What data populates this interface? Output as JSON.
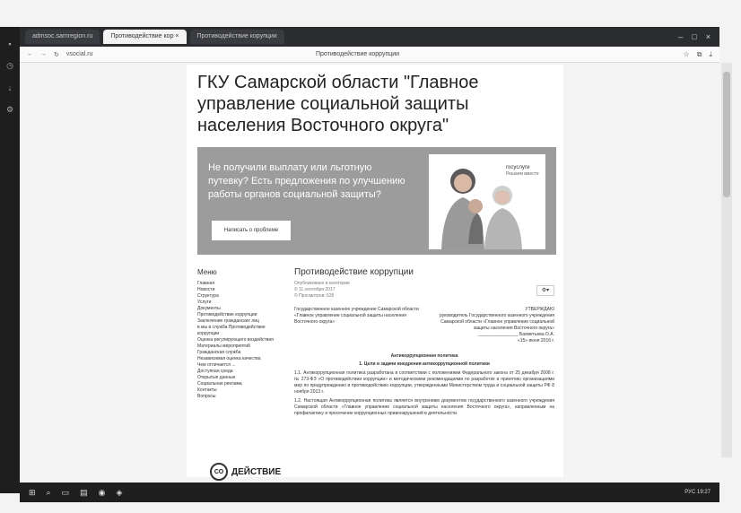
{
  "browser": {
    "tabs": [
      "admsoc.samregion.ru",
      "Противодействие кор ×",
      "Противодействие корупции"
    ],
    "page_title": "Противодействие коррупции",
    "url": "vsocial.ru"
  },
  "site": {
    "title": "ГКУ Самарской области \"Главное управление социальной защиты населения Восточного округа\""
  },
  "banner": {
    "text": "Не получили выплату или льготную путевку? Есть предложения по улучшению работы органов социальной защиты?",
    "button": "Написать о проблеме",
    "gos_label": "госуслуги",
    "gos_sub": "Решаем вместе"
  },
  "sidebar": {
    "title": "Меню",
    "items": [
      "Главная",
      "Новости",
      "Структура",
      "Услуги",
      "Документы",
      "Противодействие коррупции",
      "Заключение гражданских лиц",
      "в мы в служба Противодействие коррупции",
      "Оценка регулирующего воздействия",
      "Материалы мероприятий",
      "Гражданская служба",
      "Независимая оценка качества",
      "Чем отличается ...",
      "Доступная среда",
      "Открытые данные",
      "Социальная реклама",
      "Контакты",
      "Вопросы"
    ],
    "logo_text": "ДЕЙСТВИЕ",
    "logo_mark": "СО"
  },
  "content": {
    "heading": "Противодействие коррупции",
    "meta": "Опубликовано в категории\n© 11 сентября 2017\n© Просмотров: 635",
    "org_left": "Государственное казенное учреждение Самарской области «Главное управление социальной защиты населения Восточного округа»",
    "approved": "УТВЕРЖДАЮ\nруководитель Государственного казенного учреждения Самарской области «Главное управление социальной защиты населения Восточного округа»\n________________ Бахметьева О.А.\n«15» июня 2016 г.",
    "doc_title": "Антикоррупционная политика",
    "section1": "1. Цели и задачи внедрения антикоррупционной политики",
    "para1": "1.1. Антикоррупционная политика разработана в соответствии с положениями Федерального закона от 25 декабря 2008 г. № 273-ФЗ «О противодействии коррупции» и методическими рекомендациями по разработке и принятию организациями мер по предупреждению и противодействию коррупции, утвержденными Министерством труда и социальной защиты РФ 8 ноября 2013 г.",
    "para2": "1.2. Настоящая Антикоррупционная политика является внутренним документом государственного казенного учреждения Самарской области «Главное управление социальной защиты населения Восточного округа», направленным на профилактику и пресечение коррупционных правонарушений в деятельности."
  },
  "taskbar": {
    "tray": "РУС  19:27"
  }
}
